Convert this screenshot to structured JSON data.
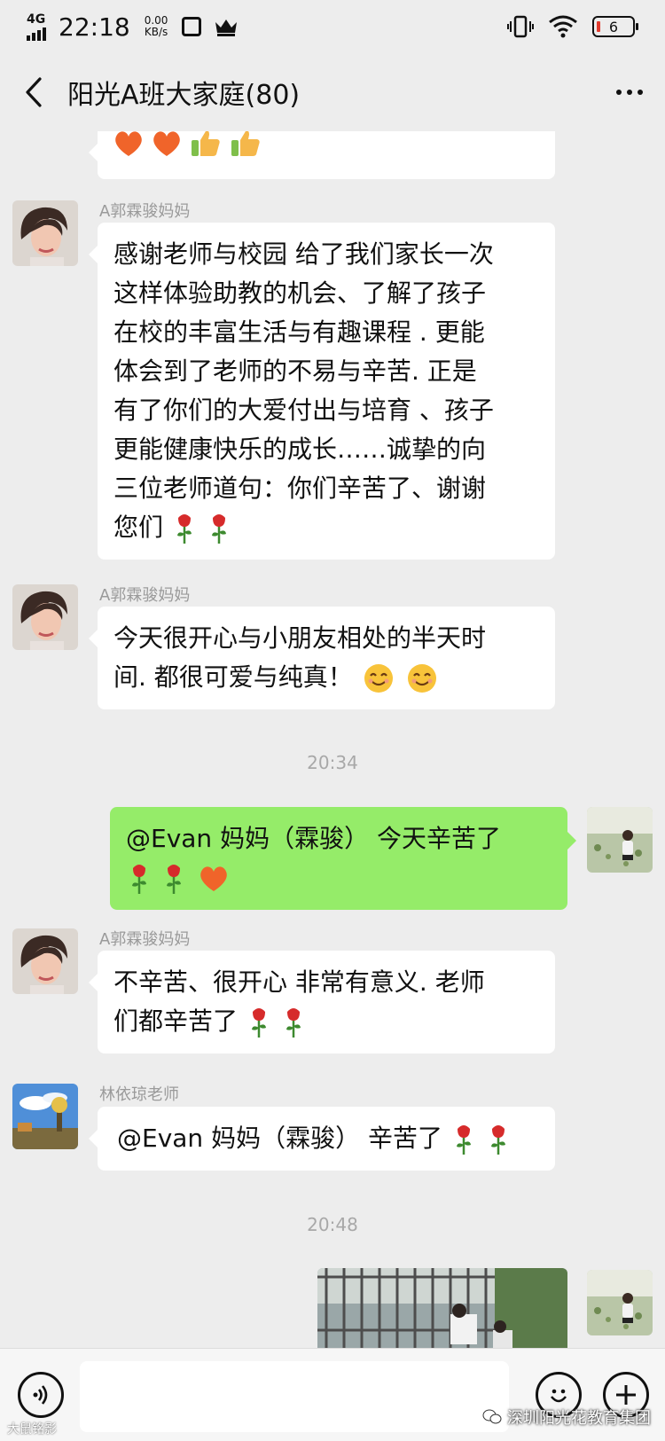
{
  "status_bar": {
    "network": "4G",
    "time": "22:18",
    "speed_value": "0.00",
    "speed_unit": "KB/s",
    "battery_level": "6"
  },
  "header": {
    "title": "阳光A班大家庭(80)"
  },
  "messages": [
    {
      "sender": "A郭霖骏妈妈",
      "text": "感谢老师与校园 给了我们家长一次这样体验助教的机会、了解了孩子在校的丰富生活与有趣课程 . 更能体会到了老师的不易与辛苦. 正是有了你们的大爱付出与培育 、孩子更能健康快乐的成长……诚挚的向三位老师道句：你们辛苦了、谢谢您们",
      "lines": [
        "感谢老师与校园 给了我们家长一次",
        "这样体验助教的机会、了解了孩子",
        "在校的丰富生活与有趣课程 . 更能",
        "体会到了老师的不易与辛苦. 正是",
        "有了你们的大爱付出与培育 、孩子",
        "更能健康快乐的成长……诚挚的向",
        "三位老师道句：你们辛苦了、谢谢",
        "您们"
      ]
    },
    {
      "sender": "A郭霖骏妈妈",
      "lines": [
        "今天很开心与小朋友相处的半天时",
        "间. 都很可爱与纯真！"
      ]
    },
    {
      "text": "@Evan 妈妈（霖骏） 今天辛苦了"
    },
    {
      "sender": "A郭霖骏妈妈",
      "lines": [
        "不辛苦、很开心 非常有意义. 老师",
        "们都辛苦了"
      ]
    },
    {
      "sender": "林依琼老师",
      "text": "@Evan 妈妈（霖骏） 辛苦了"
    }
  ],
  "timestamps": [
    "20:34",
    "20:48"
  ],
  "watermark": {
    "text": "深圳阳光花教育集团",
    "corner_text": "大鼠铭影"
  },
  "icons": {
    "voice": "voice-icon",
    "emoji": "emoji-icon",
    "plus": "plus-icon"
  },
  "colors": {
    "outgoing_bubble": "#95ec69",
    "incoming_bubble": "#ffffff",
    "background": "#ededed"
  }
}
